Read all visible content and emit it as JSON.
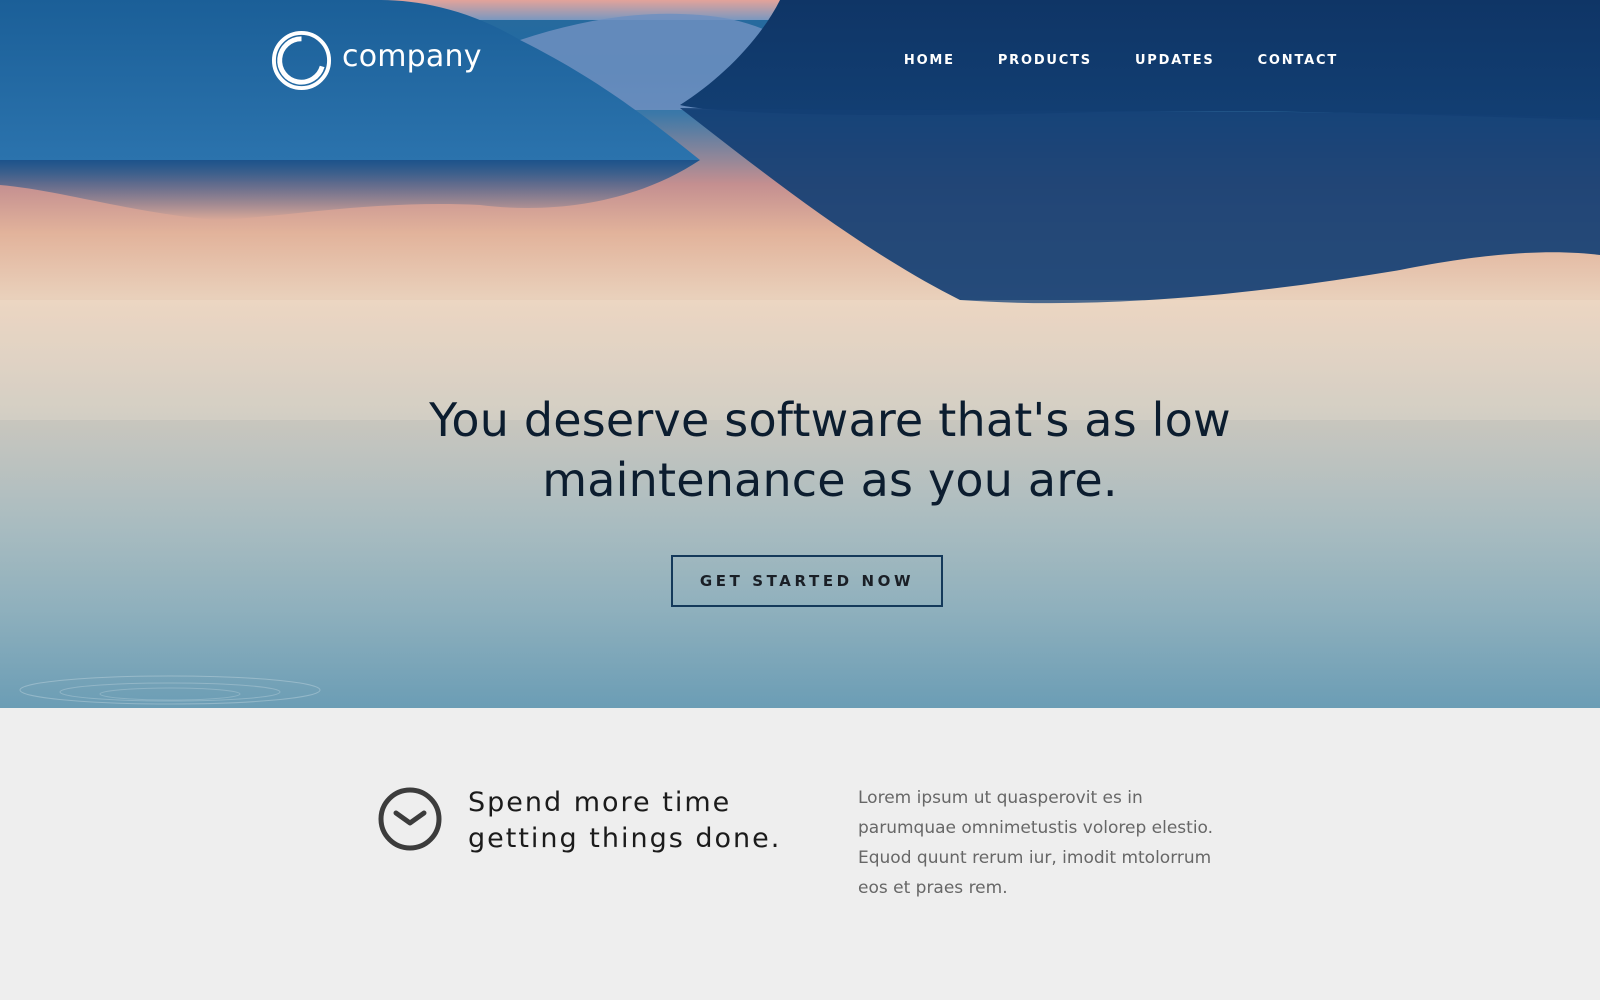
{
  "brand": {
    "name": "company"
  },
  "nav": {
    "items": [
      {
        "label": "HOME"
      },
      {
        "label": "PRODUCTS"
      },
      {
        "label": "UPDATES"
      },
      {
        "label": "CONTACT"
      }
    ]
  },
  "hero": {
    "headline": "You deserve software that's as low maintenance as you are.",
    "cta_label": "GET STARTED NOW"
  },
  "feature": {
    "icon": "clock-check-icon",
    "title": "Spend more time getting things done.",
    "text": "Lorem ipsum ut quasperovit es in parumquae omnimetustis volorep elestio. Equod quunt rerum iur, imodit mtolorrum eos et praes rem."
  },
  "colors": {
    "headline": "#0c1d2f",
    "cta_border": "#14395a",
    "feature_bg": "#eeeeee",
    "nav_text": "#ffffff"
  }
}
